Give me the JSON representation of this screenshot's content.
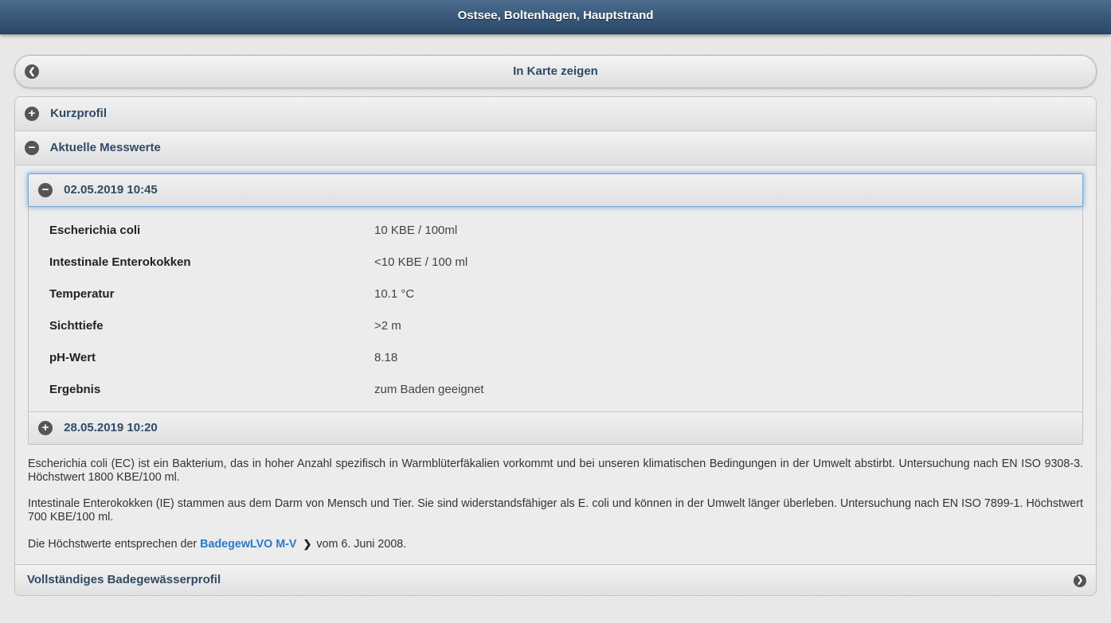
{
  "header": {
    "title": "Ostsee, Boltenhagen, Hauptstrand"
  },
  "map_button": {
    "label": "In Karte zeigen",
    "icon": "chevron-left-icon"
  },
  "sections": {
    "kurzprofil": {
      "label": "Kurzprofil",
      "icon": "plus-icon"
    },
    "messwerte": {
      "label": "Aktuelle Messwerte",
      "icon": "minus-icon"
    }
  },
  "measurements": [
    {
      "date": "02.05.2019 10:45",
      "expanded": true,
      "rows": [
        {
          "label": "Escherichia coli",
          "value": "10 KBE / 100ml"
        },
        {
          "label": "Intestinale Enterokokken",
          "value": "<10 KBE / 100 ml"
        },
        {
          "label": "Temperatur",
          "value": "10.1 °C"
        },
        {
          "label": "Sichttiefe",
          "value": ">2 m"
        },
        {
          "label": "pH-Wert",
          "value": "8.18"
        },
        {
          "label": "Ergebnis",
          "value": "zum Baden geeignet"
        }
      ]
    },
    {
      "date": "28.05.2019 10:20",
      "expanded": false
    }
  ],
  "notes": {
    "ec": "Escherichia coli (EC) ist ein Bakterium, das in hoher Anzahl spezifisch in Warmblüterfäkalien vorkommt und bei unseren klimatischen Bedingungen in der Umwelt abstirbt. Untersuchung nach EN ISO 9308-3. Höchstwert 1800 KBE/100 ml.",
    "ie": "Intestinale Enterokokken (IE) stammen aus dem Darm von Mensch und Tier. Sie sind widerstandsfähiger als E. coli und können in der Umwelt länger überleben. Untersuchung nach EN ISO 7899-1. Höchstwert 700 KBE/100 ml.",
    "limits_prefix": "Die Höchstwerte entsprechen der",
    "limits_link": "BadegewLVO M-V",
    "limits_suffix": "vom 6. Juni 2008."
  },
  "footer": {
    "label": "Vollständiges Badegewässerprofil",
    "icon": "chevron-right-icon"
  }
}
